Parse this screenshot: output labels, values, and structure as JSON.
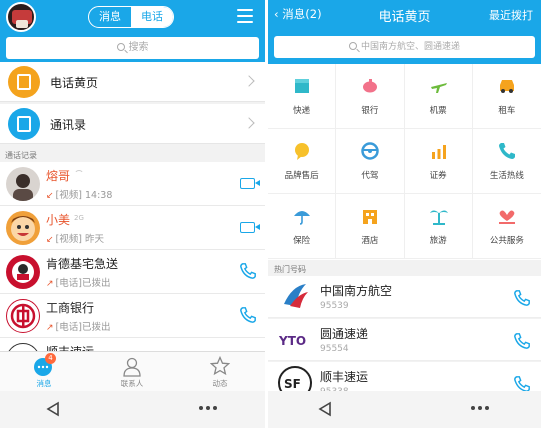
{
  "colors": {
    "accent": "#1aa7e8",
    "missed": "#e8552d",
    "badge": "#ff6a3d"
  },
  "left": {
    "segment": {
      "tab1": "消息",
      "tab2": "电话",
      "active": "电话"
    },
    "search_placeholder": "搜索",
    "nav": [
      {
        "label": "电话黄页",
        "color": "#f4a31d"
      },
      {
        "label": "通讯录",
        "color": "#1aa7e8"
      }
    ],
    "section_label": "通话记录",
    "calls": [
      {
        "name": "熔哥",
        "detail": "[视频]  14:38",
        "name_color": "missed"
      },
      {
        "name": "小美",
        "tag": "2G",
        "detail": "[视频]  昨天",
        "name_color": "missed"
      },
      {
        "name": "肯德基宅急送",
        "detail": "[电话]已拨出",
        "name_color": "normal"
      },
      {
        "name": "工商银行",
        "detail": "[电话]已拨出",
        "name_color": "normal"
      },
      {
        "name": "顺丰速运",
        "detail": "",
        "name_color": "normal"
      }
    ],
    "tabs": [
      {
        "label": "消息",
        "badge": "4",
        "icon": "chat-icon"
      },
      {
        "label": "联系人",
        "icon": "person-icon"
      },
      {
        "label": "动态",
        "icon": "star-icon"
      }
    ]
  },
  "right": {
    "back_label": "消息(2)",
    "title": "电话黄页",
    "recent_link": "最近拨打",
    "search_placeholder": "中国南方航空、圆通速递",
    "categories": [
      {
        "label": "快递",
        "icon": "box-icon"
      },
      {
        "label": "银行",
        "icon": "piggy-bank-icon"
      },
      {
        "label": "机票",
        "icon": "airplane-icon"
      },
      {
        "label": "租车",
        "icon": "car-icon"
      },
      {
        "label": "品牌售后",
        "icon": "chat-bubble-icon"
      },
      {
        "label": "代驾",
        "icon": "steering-wheel-icon"
      },
      {
        "label": "证券",
        "icon": "bar-chart-icon"
      },
      {
        "label": "生活热线",
        "icon": "phone-icon"
      },
      {
        "label": "保险",
        "icon": "umbrella-icon"
      },
      {
        "label": "酒店",
        "icon": "building-icon"
      },
      {
        "label": "旅游",
        "icon": "palm-tree-icon"
      },
      {
        "label": "公共服务",
        "icon": "heart-hand-icon"
      }
    ],
    "hot_label": "热门号码",
    "hot": [
      {
        "name": "中国南方航空",
        "number": "95539"
      },
      {
        "name": "圆通速递",
        "number": "95554"
      },
      {
        "name": "顺丰速运",
        "number": "95338"
      }
    ],
    "logo_texts": {
      "yto": "YTO",
      "sf": "SF"
    }
  }
}
